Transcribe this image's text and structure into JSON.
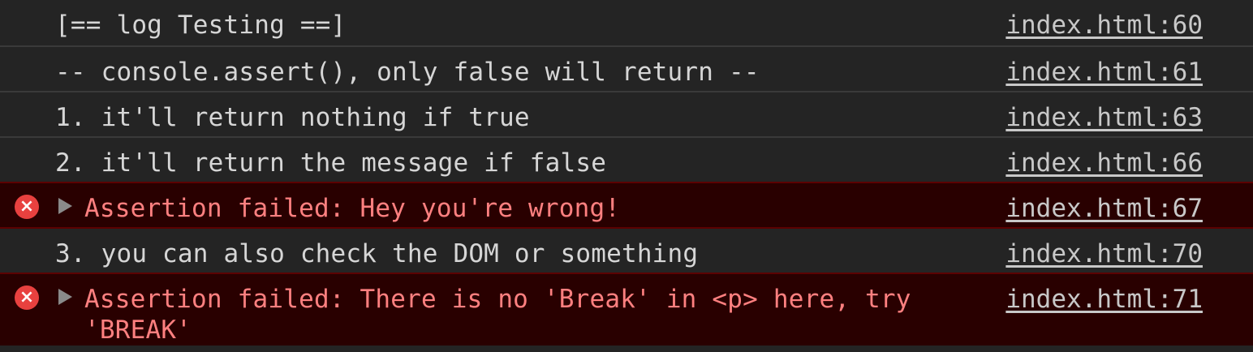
{
  "console": {
    "entries": [
      {
        "type": "log",
        "message": "[== log Testing ==]",
        "source": "index.html:60"
      },
      {
        "type": "log",
        "message": "-- console.assert(), only false will return --",
        "source": "index.html:61"
      },
      {
        "type": "log",
        "message": "1. it'll return nothing if true",
        "source": "index.html:63"
      },
      {
        "type": "log",
        "message": "2. it'll return the message if false",
        "source": "index.html:66"
      },
      {
        "type": "error",
        "message": "Assertion failed: Hey you're wrong!",
        "source": "index.html:67",
        "icon": "error-icon"
      },
      {
        "type": "log",
        "message": "3. you can also check the DOM or something",
        "source": "index.html:70"
      },
      {
        "type": "error",
        "message": "Assertion failed: There is no 'Break' in <p> here, try 'BREAK'",
        "source": "index.html:71",
        "icon": "error-icon"
      }
    ]
  },
  "icons": {
    "error_glyph": "×"
  },
  "colors": {
    "background": "#242424",
    "error_background": "#290000",
    "error_text": "#ff8080",
    "error_icon": "#e8413f"
  }
}
